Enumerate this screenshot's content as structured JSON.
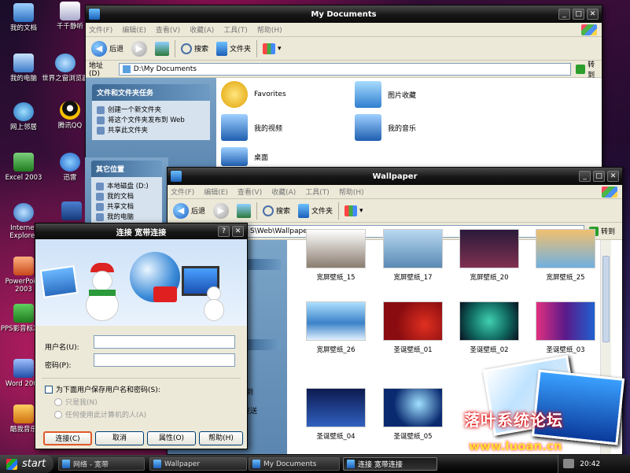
{
  "desktop_icons": [
    {
      "label": "我的文档"
    },
    {
      "label": "千千静听"
    },
    {
      "label": "我的电脑"
    },
    {
      "label": "世界之窗浏览器"
    },
    {
      "label": "网上邻居"
    },
    {
      "label": "腾讯QQ"
    },
    {
      "label": "Excel 2003"
    },
    {
      "label": "迅雷"
    },
    {
      "label": "Internet Explorer"
    },
    {
      "label": "PowerPoint 2003"
    },
    {
      "label": "PPS影音标准版"
    },
    {
      "label": "Word 2003"
    },
    {
      "label": "酷我音乐"
    }
  ],
  "my_documents": {
    "title": "My Documents",
    "menu": [
      "文件(F)",
      "编辑(E)",
      "查看(V)",
      "收藏(A)",
      "工具(T)",
      "帮助(H)"
    ],
    "toolbar": {
      "back": "后退",
      "search": "搜索",
      "folders": "文件夹"
    },
    "address_label": "地址(D)",
    "address_value": "D:\\My Documents",
    "goto": "转到",
    "tasks_header": "文件和文件夹任务",
    "tasks": [
      "创建一个新文件夹",
      "将这个文件夹发布到 Web",
      "共享此文件夹"
    ],
    "places_header": "其它位置",
    "places": [
      "本地磁盘 (D:)",
      "我的文档",
      "共享文档",
      "我的电脑"
    ],
    "items": [
      "Favorites",
      "图片收藏",
      "我的视频",
      "我的音乐",
      "桌面"
    ]
  },
  "wallpaper": {
    "title": "Wallpaper",
    "menu": [
      "文件(F)",
      "编辑(E)",
      "查看(V)",
      "收藏(A)",
      "工具(T)",
      "帮助(H)"
    ],
    "toolbar": {
      "back": "后退",
      "search": "搜索",
      "folders": "文件夹"
    },
    "address_value": "S\\Web\\Wallpaper",
    "goto": "转到",
    "side_partial": [
      "到",
      "发送"
    ],
    "thumbs": [
      {
        "label": "宽屏壁纸_15",
        "color": "#8a7c6e"
      },
      {
        "label": "宽屏壁纸_17",
        "color": "#5a8ab4"
      },
      {
        "label": "宽屏壁纸_20",
        "color": "#2a1a3a"
      },
      {
        "label": "宽屏壁纸_25",
        "color": "#f0c070"
      },
      {
        "label": "宽屏壁纸_26",
        "color": "#3b82c8"
      },
      {
        "label": "圣诞壁纸_01",
        "color": "#8a0c10"
      },
      {
        "label": "圣诞壁纸_02",
        "color": "#106a60"
      },
      {
        "label": "圣诞壁纸_03",
        "color": "#5a1a8a"
      },
      {
        "label": "圣诞壁纸_04",
        "color": "#0c1a50"
      },
      {
        "label": "圣诞壁纸_05",
        "color": "#0a2a70"
      }
    ]
  },
  "dialog": {
    "title": "连接 宽带连接",
    "help": "?",
    "close": "✕",
    "username_label": "用户名(U):",
    "username_value": "",
    "password_label": "密码(P):",
    "password_value": "",
    "save_label": "为下面用户保存用户名和密码(S):",
    "radio1": "只是我(N)",
    "radio2": "任何使用此计算机的人(A)",
    "buttons": {
      "connect": "连接(C)",
      "cancel": "取消",
      "properties": "属性(O)",
      "help": "帮助(H)"
    }
  },
  "taskbar": {
    "start": "start",
    "buttons": [
      {
        "label": "Wallpaper"
      },
      {
        "label": "My Documents"
      },
      {
        "label": "连接 宽带连接"
      }
    ],
    "partial_left": "网络 - 宽带",
    "clock": "20:42"
  },
  "watermark": {
    "line1": "落叶系统论坛",
    "line2": "www.luoan.cn"
  }
}
